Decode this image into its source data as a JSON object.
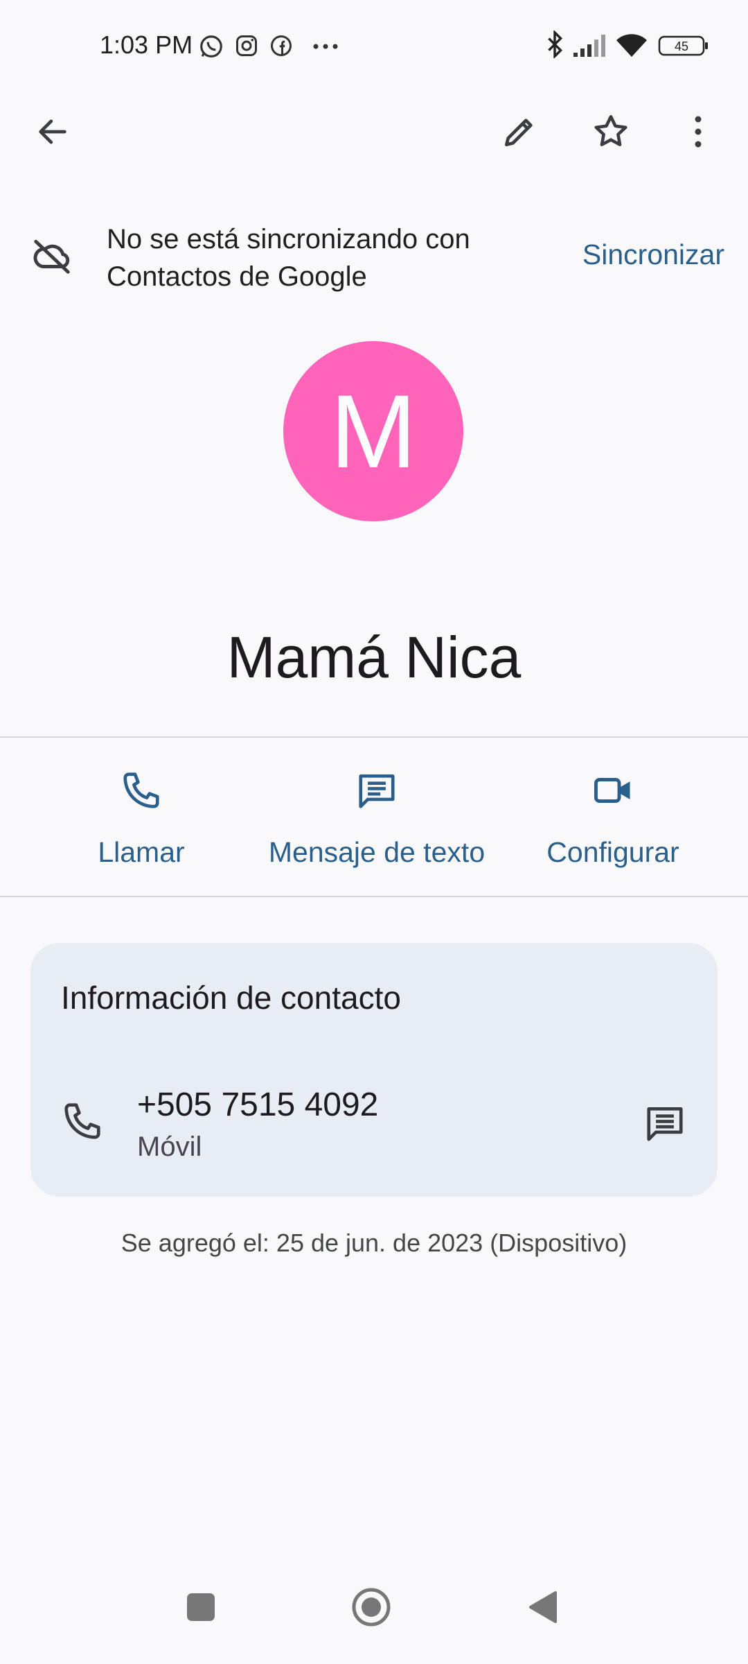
{
  "status_bar": {
    "time": "1:03 PM",
    "notification_icons": [
      "whatsapp-icon",
      "instagram-icon",
      "facebook-icon",
      "more-dots-icon"
    ],
    "battery": "45"
  },
  "top_bar": {
    "back": "arrow-back-icon",
    "actions": [
      "edit-icon",
      "star-outline-icon",
      "more-vert-icon"
    ]
  },
  "sync_banner": {
    "line1": "No se está sincronizando con",
    "line2": "Contactos de Google",
    "action_label": "Sincronizar"
  },
  "contact": {
    "avatar_letter": "M",
    "avatar_color": "#ff63ba",
    "name": "Mamá Nica"
  },
  "actions": [
    {
      "label": "Llamar",
      "icon": "phone-icon"
    },
    {
      "label": "Mensaje de texto",
      "icon": "message-icon"
    },
    {
      "label": "Configurar",
      "icon": "video-call-icon"
    }
  ],
  "contact_info": {
    "title": "Información de contacto",
    "phone": "+505 7515 4092",
    "phone_type": "Móvil"
  },
  "added_note": "Se agregó el: 25 de jun. de 2023 (Dispositivo)",
  "colors": {
    "accent": "#2a5f8c",
    "background": "#f9f9fc",
    "card": "#e8ecf3"
  }
}
